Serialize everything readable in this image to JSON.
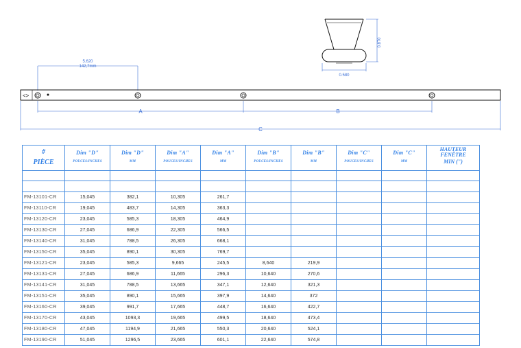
{
  "drawing": {
    "top_dim_line1": "5.620",
    "top_dim_line2": "142,7mm",
    "arrow_symbol": "<>",
    "label_a": "A",
    "label_b": "B",
    "label_c": "C",
    "knob_height": "0.870",
    "knob_width": "0.580"
  },
  "table": {
    "headers": [
      {
        "main": "#",
        "sub": "PIÈCE"
      },
      {
        "main": "Dim \"D\"",
        "sub": "POUCES/INCHES"
      },
      {
        "main": "Dim \"D\"",
        "sub": "MM"
      },
      {
        "main": "Dim \"A\"",
        "sub": "POUCES/INCHES"
      },
      {
        "main": "Dim \"A\"",
        "sub": "MM"
      },
      {
        "main": "Dim \"B\"",
        "sub": "POUCES/INCHES"
      },
      {
        "main": "Dim \"B\"",
        "sub": "MM"
      },
      {
        "main": "Dim \"C\"",
        "sub": "POUCES/INCHES"
      },
      {
        "main": "Dim \"C\"",
        "sub": "MM"
      },
      {
        "main": "HAUTEUR FENÊTRE",
        "sub": "MIN (\")"
      }
    ],
    "rows": [
      [
        "FM-13101-CR",
        "15,045",
        "382,1",
        "10,305",
        "261,7",
        "",
        "",
        "",
        "",
        ""
      ],
      [
        "FM-13110-CR",
        "19,045",
        "483,7",
        "14,305",
        "363,3",
        "",
        "",
        "",
        "",
        ""
      ],
      [
        "FM-13120-CR",
        "23,045",
        "585,3",
        "18,305",
        "464,9",
        "",
        "",
        "",
        "",
        ""
      ],
      [
        "FM-13130-CR",
        "27,045",
        "686,9",
        "22,305",
        "566,5",
        "",
        "",
        "",
        "",
        ""
      ],
      [
        "FM-13140-CR",
        "31,045",
        "788,5",
        "26,305",
        "668,1",
        "",
        "",
        "",
        "",
        ""
      ],
      [
        "FM-13150-CR",
        "35,045",
        "890,1",
        "30,305",
        "769,7",
        "",
        "",
        "",
        "",
        ""
      ],
      [
        "FM-13121-CR",
        "23,045",
        "585,3",
        "9,665",
        "245,5",
        "8,640",
        "219,9",
        "",
        "",
        ""
      ],
      [
        "FM-13131-CR",
        "27,045",
        "686,9",
        "11,665",
        "296,3",
        "10,640",
        "270,6",
        "",
        "",
        ""
      ],
      [
        "FM-13141-CR",
        "31,045",
        "788,5",
        "13,665",
        "347,1",
        "12,640",
        "321,3",
        "",
        "",
        ""
      ],
      [
        "FM-13151-CR",
        "35,045",
        "890,1",
        "15,665",
        "397,9",
        "14,640",
        "372",
        "",
        "",
        ""
      ],
      [
        "FM-13160-CR",
        "39,045",
        "991,7",
        "17,665",
        "448,7",
        "16,640",
        "422,7",
        "",
        "",
        ""
      ],
      [
        "FM-13170-CR",
        "43,045",
        "1093,3",
        "19,665",
        "499,5",
        "18,640",
        "473,4",
        "",
        "",
        ""
      ],
      [
        "FM-13180-CR",
        "47,045",
        "1194,9",
        "21,665",
        "550,3",
        "20,640",
        "524,1",
        "",
        "",
        ""
      ],
      [
        "FM-13190-CR",
        "51,045",
        "1296,5",
        "23,665",
        "601,1",
        "22,640",
        "574,8",
        "",
        "",
        ""
      ]
    ]
  }
}
